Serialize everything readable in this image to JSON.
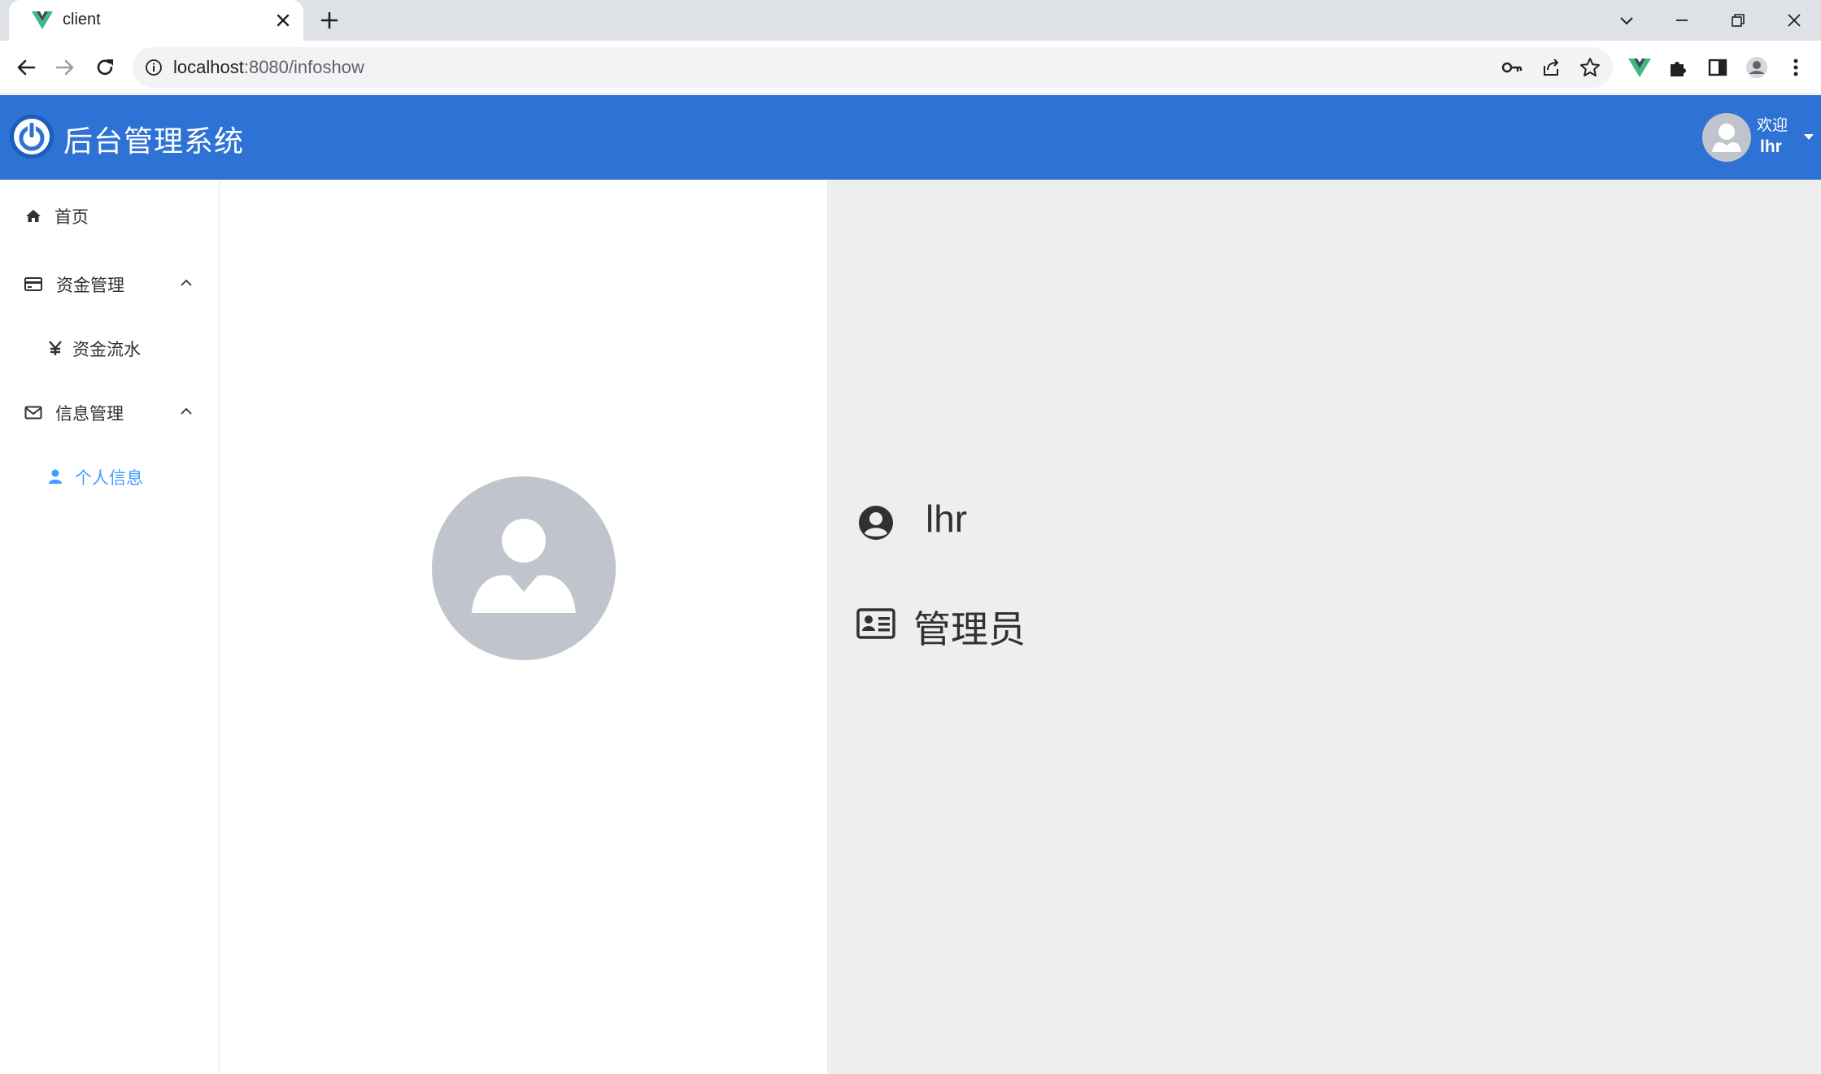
{
  "browser": {
    "tab_title": "client",
    "url_host": "localhost",
    "url_path": ":8080/infoshow"
  },
  "header": {
    "app_title": "后台管理系统",
    "welcome": "欢迎",
    "username": "lhr"
  },
  "sidebar": {
    "items": [
      {
        "label": "首页",
        "icon": "home-icon"
      },
      {
        "label": "资金管理",
        "icon": "credit-card-icon",
        "expanded": true
      },
      {
        "label": "资金流水",
        "icon": "yen-icon"
      },
      {
        "label": "信息管理",
        "icon": "envelope-icon",
        "expanded": true
      },
      {
        "label": "个人信息",
        "icon": "user-icon",
        "active": true
      }
    ]
  },
  "profile": {
    "name": "lhr",
    "role": "管理员"
  },
  "colors": {
    "header_bg": "#2d72d4",
    "active_menu": "#409eff",
    "avatar_bg": "#c0c4cc",
    "right_panel_bg": "#eeeeee"
  }
}
